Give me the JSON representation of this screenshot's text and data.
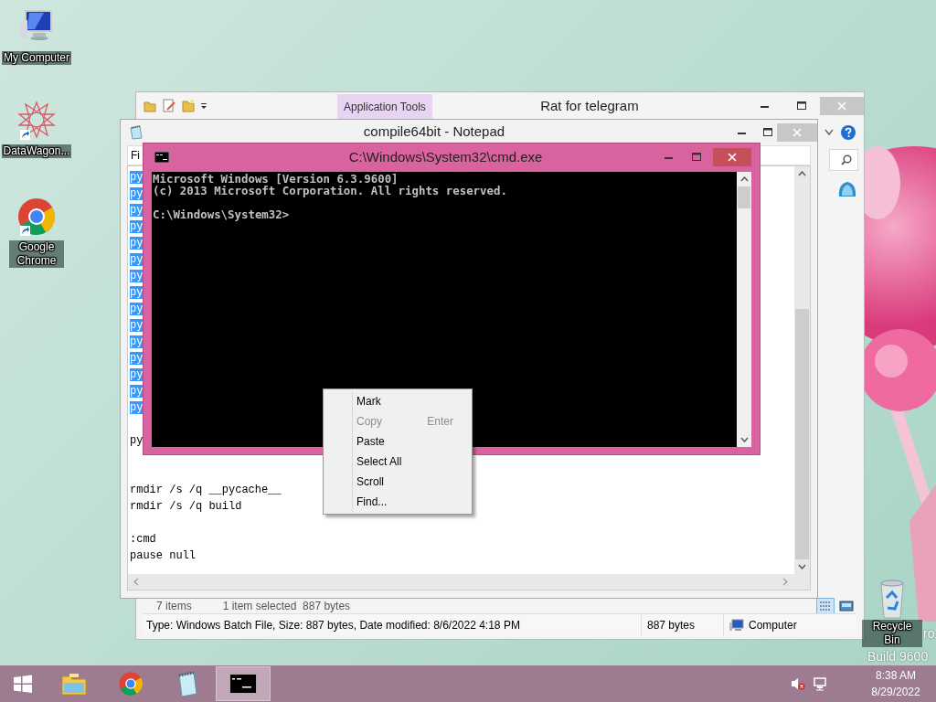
{
  "desktop": {
    "icons": [
      {
        "label": "My Computer",
        "kind": "computer"
      },
      {
        "label": "DataWagon...",
        "kind": "star"
      },
      {
        "label": "Google Chrome",
        "kind": "chrome"
      },
      {
        "label": "Recycle Bin",
        "kind": "recycle"
      }
    ],
    "watermark": {
      "edition": "ro",
      "build": "Build 9600"
    }
  },
  "explorer": {
    "title": "Rat for telegram",
    "ribbon_tab": "Application Tools",
    "status": {
      "items": "7 items",
      "selection": "1 item selected  887 bytes"
    },
    "details_bar": {
      "info": "Type: Windows Batch File, Size: 887 bytes, Date modified: 8/6/2022 4:18 PM",
      "size": "887 bytes",
      "location": "Computer"
    }
  },
  "notepad": {
    "title": "compile64bit - Notepad",
    "menu": "Fi",
    "lines": [
      {
        "kind": "text",
        "text": "py",
        "selected": true
      },
      {
        "kind": "text",
        "text": "py",
        "selected": true
      },
      {
        "kind": "text",
        "text": "py",
        "selected": true
      },
      {
        "kind": "text",
        "text": "py",
        "selected": true
      },
      {
        "kind": "text",
        "text": "py",
        "selected": true
      },
      {
        "kind": "text",
        "text": "py",
        "selected": true
      },
      {
        "kind": "text",
        "text": "py",
        "selected": true
      },
      {
        "kind": "text",
        "text": "py",
        "selected": true
      },
      {
        "kind": "text",
        "text": "py",
        "selected": true
      },
      {
        "kind": "text",
        "text": "py",
        "selected": true
      },
      {
        "kind": "text",
        "text": "py",
        "selected": true
      },
      {
        "kind": "text",
        "text": "py",
        "selected": true
      },
      {
        "kind": "text",
        "text": "py",
        "selected": true
      },
      {
        "kind": "text",
        "text": "py",
        "selected": true
      },
      {
        "kind": "text",
        "text": "py",
        "selected": true
      },
      {
        "kind": "blank"
      },
      {
        "kind": "text",
        "text": "py",
        "selected": false
      },
      {
        "kind": "blank"
      },
      {
        "kind": "blank"
      },
      {
        "kind": "text",
        "text": "rmdir /s /q __pycache__",
        "selected": false
      },
      {
        "kind": "text",
        "text": "rmdir /s /q build",
        "selected": false
      },
      {
        "kind": "blank"
      },
      {
        "kind": "text",
        "text": ":cmd",
        "selected": false
      },
      {
        "kind": "text",
        "text": "pause null",
        "selected": false
      }
    ]
  },
  "cmd": {
    "title": "C:\\Windows\\System32\\cmd.exe",
    "output": [
      "Microsoft Windows [Version 6.3.9600]",
      "(c) 2013 Microsoft Corporation. All rights reserved."
    ],
    "prompt": "C:\\Windows\\System32>"
  },
  "context_menu": {
    "items": [
      {
        "label": "Mark",
        "disabled": false
      },
      {
        "label": "Copy",
        "shortcut": "Enter",
        "disabled": true
      },
      {
        "label": "Paste",
        "disabled": false
      },
      {
        "label": "Select All",
        "disabled": false
      },
      {
        "label": "Scroll",
        "disabled": false
      },
      {
        "label": "Find...",
        "disabled": false
      }
    ]
  },
  "taskbar": {
    "buttons": [
      {
        "kind": "start",
        "selected": false
      },
      {
        "kind": "explorer",
        "selected": false
      },
      {
        "kind": "chrome",
        "selected": false
      },
      {
        "kind": "notepad",
        "selected": false
      },
      {
        "kind": "cmd",
        "selected": true
      }
    ],
    "tray": {
      "volume_muted": true
    },
    "clock": {
      "time": "8:38 AM",
      "date": "8/29/2022"
    }
  }
}
